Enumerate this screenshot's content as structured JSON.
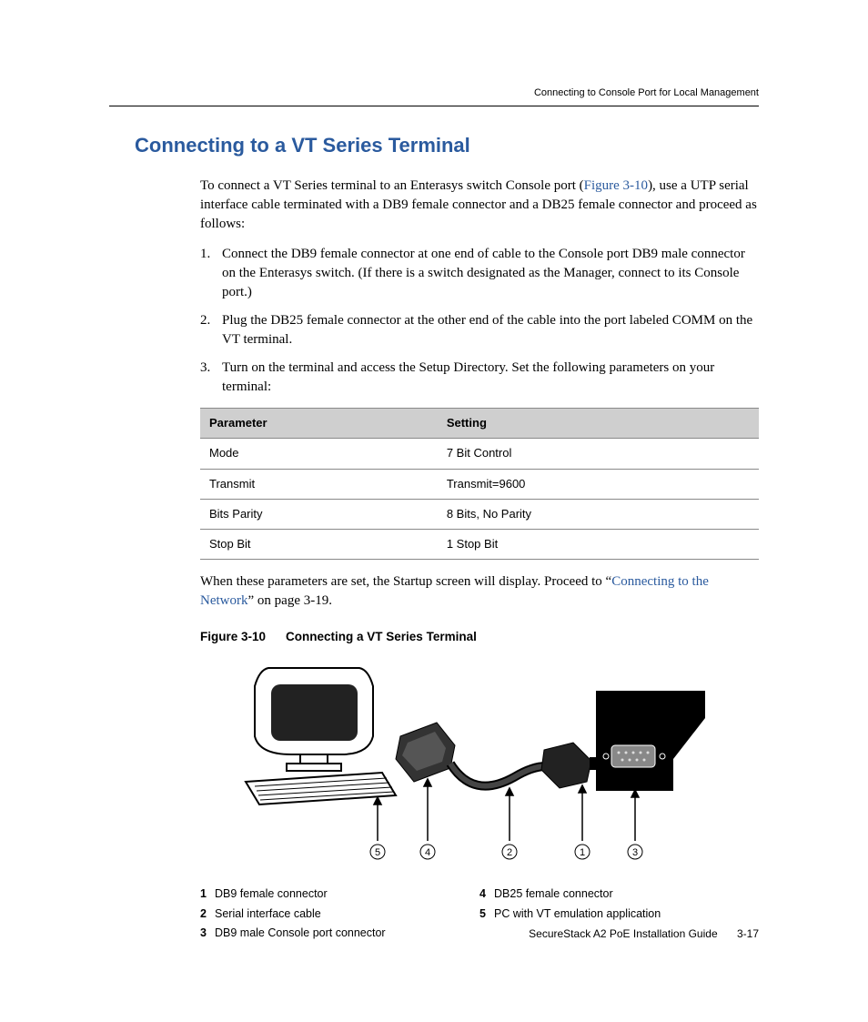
{
  "running_head": "Connecting to Console Port for Local Management",
  "section_title": "Connecting to a VT Series Terminal",
  "intro_pre": "To connect a VT Series terminal to an Enterasys switch Console port (",
  "intro_link": "Figure 3-10",
  "intro_post": "), use a UTP serial interface cable terminated with a DB9 female connector and a DB25 female connector and proceed as follows:",
  "steps": [
    {
      "n": "1.",
      "t": "Connect the DB9 female connector at one end of cable to the Console port DB9 male connector on the Enterasys switch. (If there is a switch designated as the Manager, connect to its Console port.)"
    },
    {
      "n": "2.",
      "t": "Plug the DB25 female connector at the other end of the cable into the port labeled COMM on the VT terminal."
    },
    {
      "n": "3.",
      "t": "Turn on the terminal and access the Setup Directory. Set the following parameters on your terminal:"
    }
  ],
  "table": {
    "headers": [
      "Parameter",
      "Setting"
    ],
    "rows": [
      [
        "Mode",
        "7 Bit Control"
      ],
      [
        "Transmit",
        "Transmit=9600"
      ],
      [
        "Bits Parity",
        "8 Bits, No Parity"
      ],
      [
        "Stop Bit",
        "1 Stop Bit"
      ]
    ]
  },
  "closing_pre": "When these parameters are set, the Startup screen will display. Proceed to “",
  "closing_link": "Connecting to the Network",
  "closing_post": "” on page 3-19.",
  "figure": {
    "num": "Figure 3-10",
    "title": "Connecting a VT Series Terminal",
    "callout_order": [
      "➄",
      "➃",
      "➁",
      "➀",
      "➂"
    ]
  },
  "legend": {
    "left": [
      {
        "n": "1",
        "t": "DB9 female connector"
      },
      {
        "n": "2",
        "t": "Serial interface cable"
      },
      {
        "n": "3",
        "t": "DB9 male Console port connector"
      }
    ],
    "right": [
      {
        "n": "4",
        "t": "DB25 female connector"
      },
      {
        "n": "5",
        "t": "PC with VT emulation application"
      }
    ]
  },
  "footer": {
    "doc": "SecureStack A2 PoE Installation Guide",
    "page": "3-17"
  }
}
